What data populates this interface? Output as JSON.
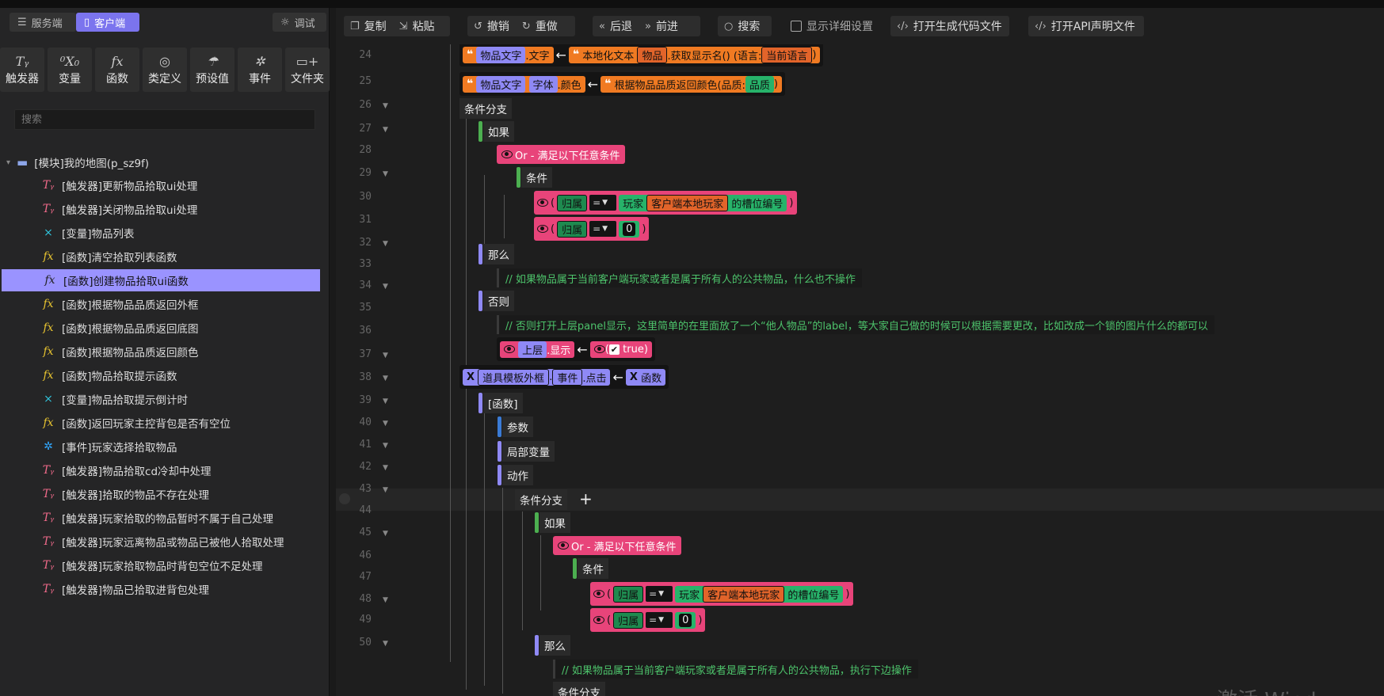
{
  "left": {
    "modes": {
      "server": "服务端",
      "client": "客户端",
      "debug": "调试"
    },
    "toolbox": [
      {
        "icon": "Tᵧ",
        "label": "触发器"
      },
      {
        "icon": "⁰X₀",
        "label": "变量"
      },
      {
        "icon": "fx",
        "label": "函数"
      },
      {
        "icon": "◎",
        "label": "类定义"
      },
      {
        "icon": "☂",
        "label": "预设值"
      },
      {
        "icon": "✲",
        "label": "事件"
      },
      {
        "icon": "▭+",
        "label": "文件夹"
      }
    ],
    "search_placeholder": "搜索",
    "root": "[模块]我的地图(p_sz9f)",
    "items": [
      {
        "type": "trigger",
        "label": "[触发器]更新物品拾取ui处理"
      },
      {
        "type": "trigger",
        "label": "[触发器]关闭物品拾取ui处理"
      },
      {
        "type": "var",
        "label": "[变量]物品列表"
      },
      {
        "type": "func",
        "label": "[函数]清空拾取列表函数"
      },
      {
        "type": "func",
        "label": "[函数]创建物品拾取ui函数"
      },
      {
        "type": "func",
        "label": "[函数]根据物品品质返回外框"
      },
      {
        "type": "func",
        "label": "[函数]根据物品品质返回底图"
      },
      {
        "type": "func",
        "label": "[函数]根据物品品质返回颜色"
      },
      {
        "type": "func",
        "label": "[函数]物品拾取提示函数"
      },
      {
        "type": "var",
        "label": "[变量]物品拾取提示倒计时"
      },
      {
        "type": "func",
        "label": "[函数]返回玩家主控背包是否有空位"
      },
      {
        "type": "event",
        "label": "[事件]玩家选择拾取物品"
      },
      {
        "type": "trigger",
        "label": "[触发器]物品拾取cd冷却中处理"
      },
      {
        "type": "trigger",
        "label": "[触发器]拾取的物品不存在处理"
      },
      {
        "type": "trigger",
        "label": "[触发器]玩家拾取的物品暂时不属于自己处理"
      },
      {
        "type": "trigger",
        "label": "[触发器]玩家远离物品或物品已被他人拾取处理"
      },
      {
        "type": "trigger",
        "label": "[触发器]玩家拾取物品时背包空位不足处理"
      },
      {
        "type": "trigger",
        "label": "[触发器]物品已拾取进背包处理"
      }
    ]
  },
  "toolbar": {
    "copy": "复制",
    "paste": "粘贴",
    "undo": "撤销",
    "redo": "重做",
    "back": "后退",
    "forward": "前进",
    "search": "搜索",
    "show_details": "显示详细设置",
    "open_codegen": "打开生成代码文件",
    "open_api": "打开API声明文件"
  },
  "code": {
    "line_numbers": [
      "24",
      "25",
      "26",
      "27",
      "28",
      "29",
      "30",
      "31",
      "32",
      "33",
      "34",
      "35",
      "36",
      "37",
      "38",
      "39",
      "40",
      "41",
      "42",
      "43",
      "44",
      "45",
      "46",
      "47",
      "48",
      "49",
      "50"
    ],
    "l24": {
      "a": "物品文字",
      "b": ".文字",
      "c": "本地化文本",
      "d": "物品",
      "e": ".获取显示名()",
      "f": "(语言:",
      "g": "当前语言",
      "h": ")"
    },
    "l25": {
      "a": "物品文字",
      "b": "字体",
      "c": ".颜色",
      "d": "根据物品品质返回颜色(品质:",
      "e": "品质",
      "f": ")"
    },
    "l26": "条件分支",
    "l27": "如果",
    "l28": "Or - 满足以下任意条件",
    "l29": "条件",
    "l30": {
      "a": "归属",
      "op": "=",
      "b": "玩家",
      "c": "客户端本地玩家",
      "d": "的槽位编号"
    },
    "l31": {
      "a": "归属",
      "op": "=",
      "b": "0"
    },
    "l32": "那么",
    "l33": "// 如果物品属于当前客户端玩家或者是属于所有人的公共物品，什么也不操作",
    "l34": "否则",
    "l35": "// 否则打开上层panel显示，这里简单的在里面放了一个“他人物品”的label，等大家自己做的时候可以根据需要更改，比如改成一个锁的图片什么的都可以",
    "l36": {
      "a": "上层",
      "b": ".显示",
      "c": "true"
    },
    "l37": {
      "a": "道具模板外框",
      "b": "事件",
      "c": ".点击",
      "d": "函数"
    },
    "l38": "[函数]",
    "l39": "参数",
    "l40": "局部变量",
    "l41": "动作",
    "l42": "条件分支",
    "l43": "如果",
    "l44": "Or - 满足以下任意条件",
    "l45": "条件",
    "l46": {
      "a": "归属",
      "op": "=",
      "b": "玩家",
      "c": "客户端本地玩家",
      "d": "的槽位编号"
    },
    "l47": {
      "a": "归属",
      "op": "=",
      "b": "0"
    },
    "l48": "那么",
    "l49": "// 如果物品属于当前客户端玩家或者是属于所有人的公共物品，执行下边操作",
    "l50": "条件分支"
  },
  "colors": {
    "accent": "#7b74ee",
    "selected": "#9a93ff",
    "comment": "#4dc36b",
    "pink": "#e8447a",
    "orange": "#f07a22",
    "green": "#1f9c5b"
  },
  "watermark": "激活 Wind"
}
